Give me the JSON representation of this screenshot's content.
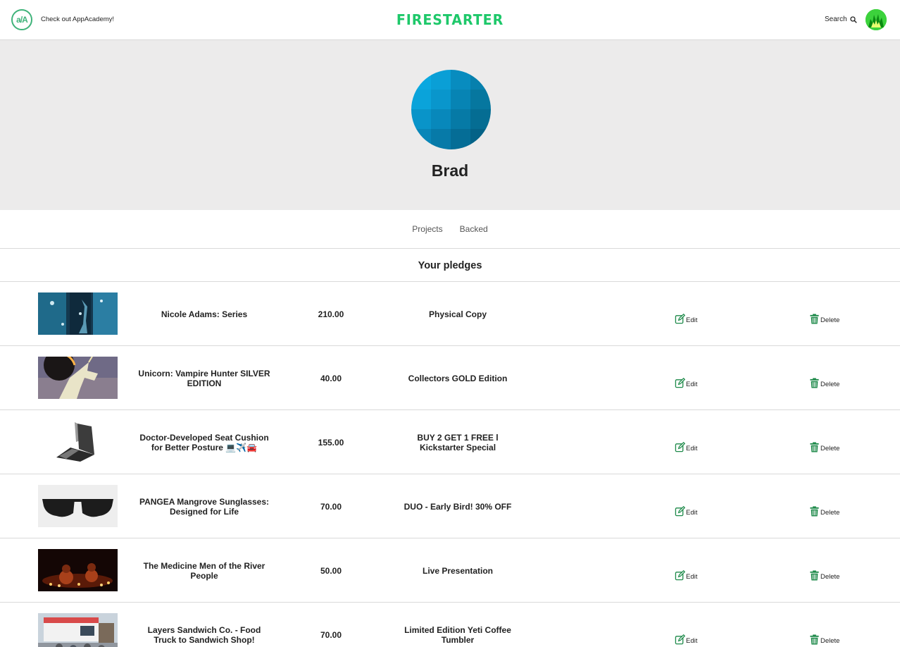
{
  "header": {
    "aa_logo_text": "a/A",
    "aa_link_text": "Check out AppAcademy!",
    "brand": "FIRESTARTER",
    "search_label": "Search",
    "colors": {
      "brand": "#1ec86a",
      "aa": "#3fb37a"
    }
  },
  "profile": {
    "name": "Brad"
  },
  "tabs": [
    {
      "label": "Projects"
    },
    {
      "label": "Backed"
    }
  ],
  "section": {
    "title": "Your pledges"
  },
  "actions": {
    "edit_label": "Edit",
    "delete_label": "Delete",
    "edit_icon": "edit-icon",
    "delete_icon": "trash-icon",
    "icon_color": "#1e8a4a"
  },
  "pledges": [
    {
      "title": "Nicole Adams: Series",
      "amount": "210.00",
      "reward": "Physical Copy"
    },
    {
      "title": "Unicorn: Vampire Hunter SILVER EDITION",
      "amount": "40.00",
      "reward": "Collectors GOLD Edition"
    },
    {
      "title": "Doctor-Developed Seat Cushion for Better Posture 💻✈️🚘",
      "amount": "155.00",
      "reward": "BUY 2 GET 1 FREE l Kickstarter Special"
    },
    {
      "title": "PANGEA Mangrove Sunglasses: Designed for Life",
      "amount": "70.00",
      "reward": "DUO - Early Bird! 30% OFF"
    },
    {
      "title": "The Medicine Men of the River People",
      "amount": "50.00",
      "reward": "Live Presentation"
    },
    {
      "title": "Layers Sandwich Co. - Food Truck to Sandwich Shop!",
      "amount": "70.00",
      "reward": "Limited Edition Yeti Coffee Tumbler"
    }
  ]
}
